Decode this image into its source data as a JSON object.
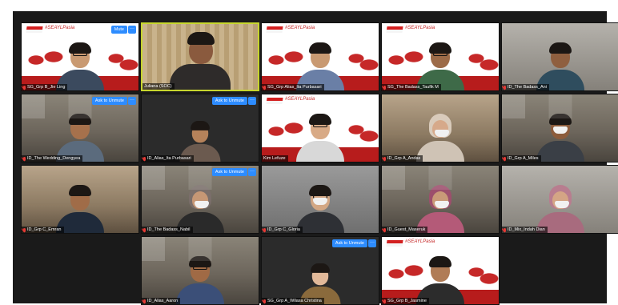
{
  "brand_tag": "#SEAYLPasia",
  "colors": {
    "accent_button": "#2d8cff",
    "active_speaker_border": "#c7d62e",
    "muted_mic": "#e53935",
    "banner_red": "#c62828"
  },
  "icons": {
    "mic_muted": "mic-muted-icon",
    "more": "more-options-icon"
  },
  "more_label": "···",
  "tiles": [
    {
      "name": "SG_Grp B_Jie Ling",
      "action": "Mute"
    },
    {
      "name": "Juliana (SOC)",
      "action": ""
    },
    {
      "name": "SG_Grp Alias_Ita Purbasari",
      "action": ""
    },
    {
      "name": "SG_The Badass_Taufik M",
      "action": ""
    },
    {
      "name": "ID_The Badass_Ani",
      "action": ""
    },
    {
      "name": "ID_The Wedding_Dengyea",
      "action": "Ask to Unmute"
    },
    {
      "name": "ID_Alias_Ita Purbasari",
      "action": "Ask to Unmute"
    },
    {
      "name": "Kim Lefuze",
      "action": ""
    },
    {
      "name": "ID_Grp A_Andas",
      "action": ""
    },
    {
      "name": "ID_Grp A_Miles",
      "action": ""
    },
    {
      "name": "ID_Grp C_Emran",
      "action": ""
    },
    {
      "name": "ID_The Badass_Nabil",
      "action": "Ask to Unmute"
    },
    {
      "name": "ID_Grp C_Gloria",
      "action": ""
    },
    {
      "name": "ID_Guest_Maseruk",
      "action": ""
    },
    {
      "name": "ID_Mix_Indah Dian",
      "action": ""
    },
    {
      "name": "ID_Alias_Aaron",
      "action": ""
    },
    {
      "name": "SG_Grp A_Wilasa Christina",
      "action": "Ask to Unmute"
    },
    {
      "name": "SG_Grp B_Jasmine",
      "action": ""
    }
  ]
}
